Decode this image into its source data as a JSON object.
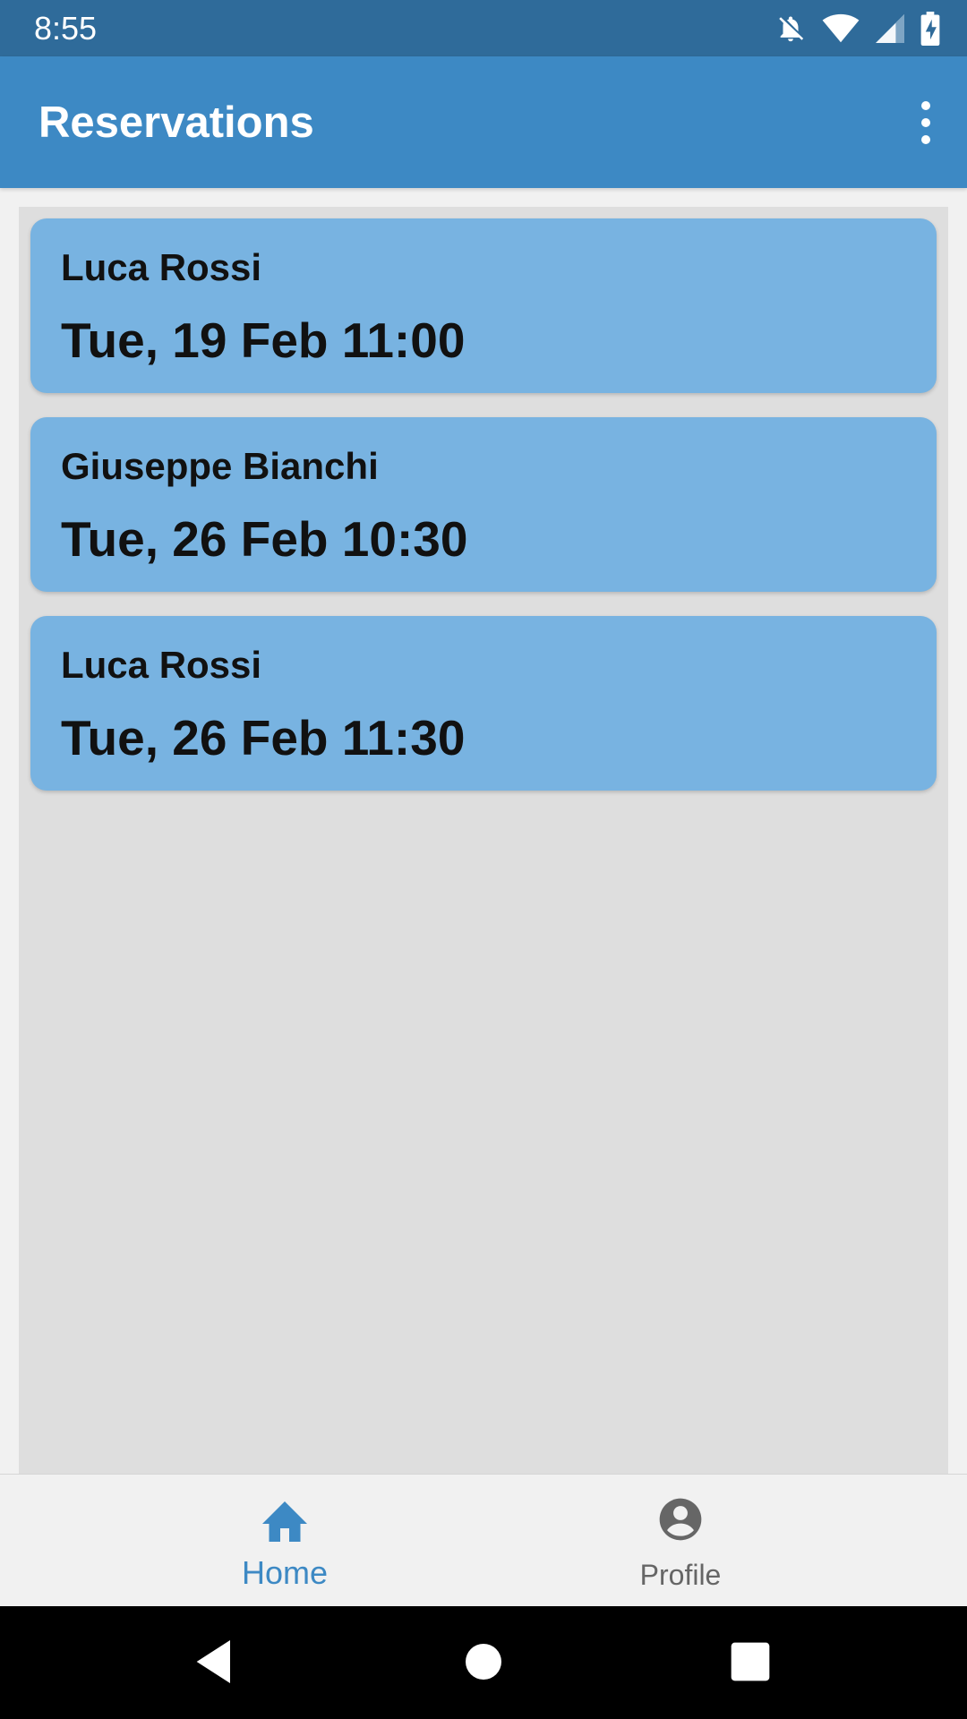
{
  "status_bar": {
    "time": "8:55",
    "icons": [
      "notifications-off-icon",
      "wifi-icon",
      "cell-signal-icon",
      "battery-charging-icon"
    ]
  },
  "app_bar": {
    "title": "Reservations",
    "menu_icon": "more-vert-icon"
  },
  "reservations": [
    {
      "name": "Luca Rossi",
      "datetime": "Tue, 19 Feb 11:00"
    },
    {
      "name": "Giuseppe Bianchi",
      "datetime": "Tue, 26 Feb 10:30"
    },
    {
      "name": "Luca Rossi",
      "datetime": "Tue, 26 Feb 11:30"
    }
  ],
  "bottom_nav": {
    "items": [
      {
        "label": "Home",
        "icon": "home-icon",
        "selected": true
      },
      {
        "label": "Profile",
        "icon": "account-circle-icon",
        "selected": false
      }
    ]
  },
  "system_nav": {
    "icons": [
      "back-icon",
      "home-circle-icon",
      "recents-icon"
    ]
  },
  "colors": {
    "status_bar": "#2f6b9a",
    "app_bar": "#3d89c4",
    "card": "#78b3e1",
    "list_background": "#dedede",
    "nav_selected": "#3d89c4",
    "nav_unselected": "#666666"
  }
}
